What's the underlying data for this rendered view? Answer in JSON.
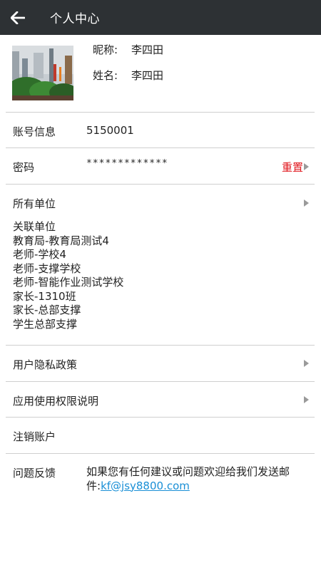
{
  "header": {
    "title": "个人中心",
    "back_icon": "arrow-left-icon"
  },
  "profile": {
    "nickname_label": "昵称:",
    "nickname": "李四田",
    "name_label": "姓名:",
    "name": "李四田",
    "avatar_icon": "avatar-photo"
  },
  "account": {
    "label": "账号信息",
    "value": "5150001"
  },
  "password": {
    "label": "密码",
    "value": "*************",
    "reset_label": "重置"
  },
  "units": {
    "label": "所有单位",
    "list": [
      "关联单位",
      "教育局-教育局测试4",
      "老师-学校4",
      "老师-支撑学校",
      "老师-智能作业测试学校",
      "家长-1310班",
      "家长-总部支撑",
      "学生总部支撑"
    ]
  },
  "privacy": {
    "label": "用户隐私政策"
  },
  "permissions": {
    "label": "应用使用权限说明"
  },
  "deactivate": {
    "label": "注销账户"
  },
  "feedback": {
    "label": "问题反馈",
    "text": "如果您有任何建议或问题欢迎给我们发送邮件:",
    "email": "kf@jsy8800.com"
  },
  "colors": {
    "header_bg": "#2d3134",
    "reset_red": "#e0161c",
    "link_blue": "#1a8fd6",
    "divider": "#cfcfcf"
  }
}
